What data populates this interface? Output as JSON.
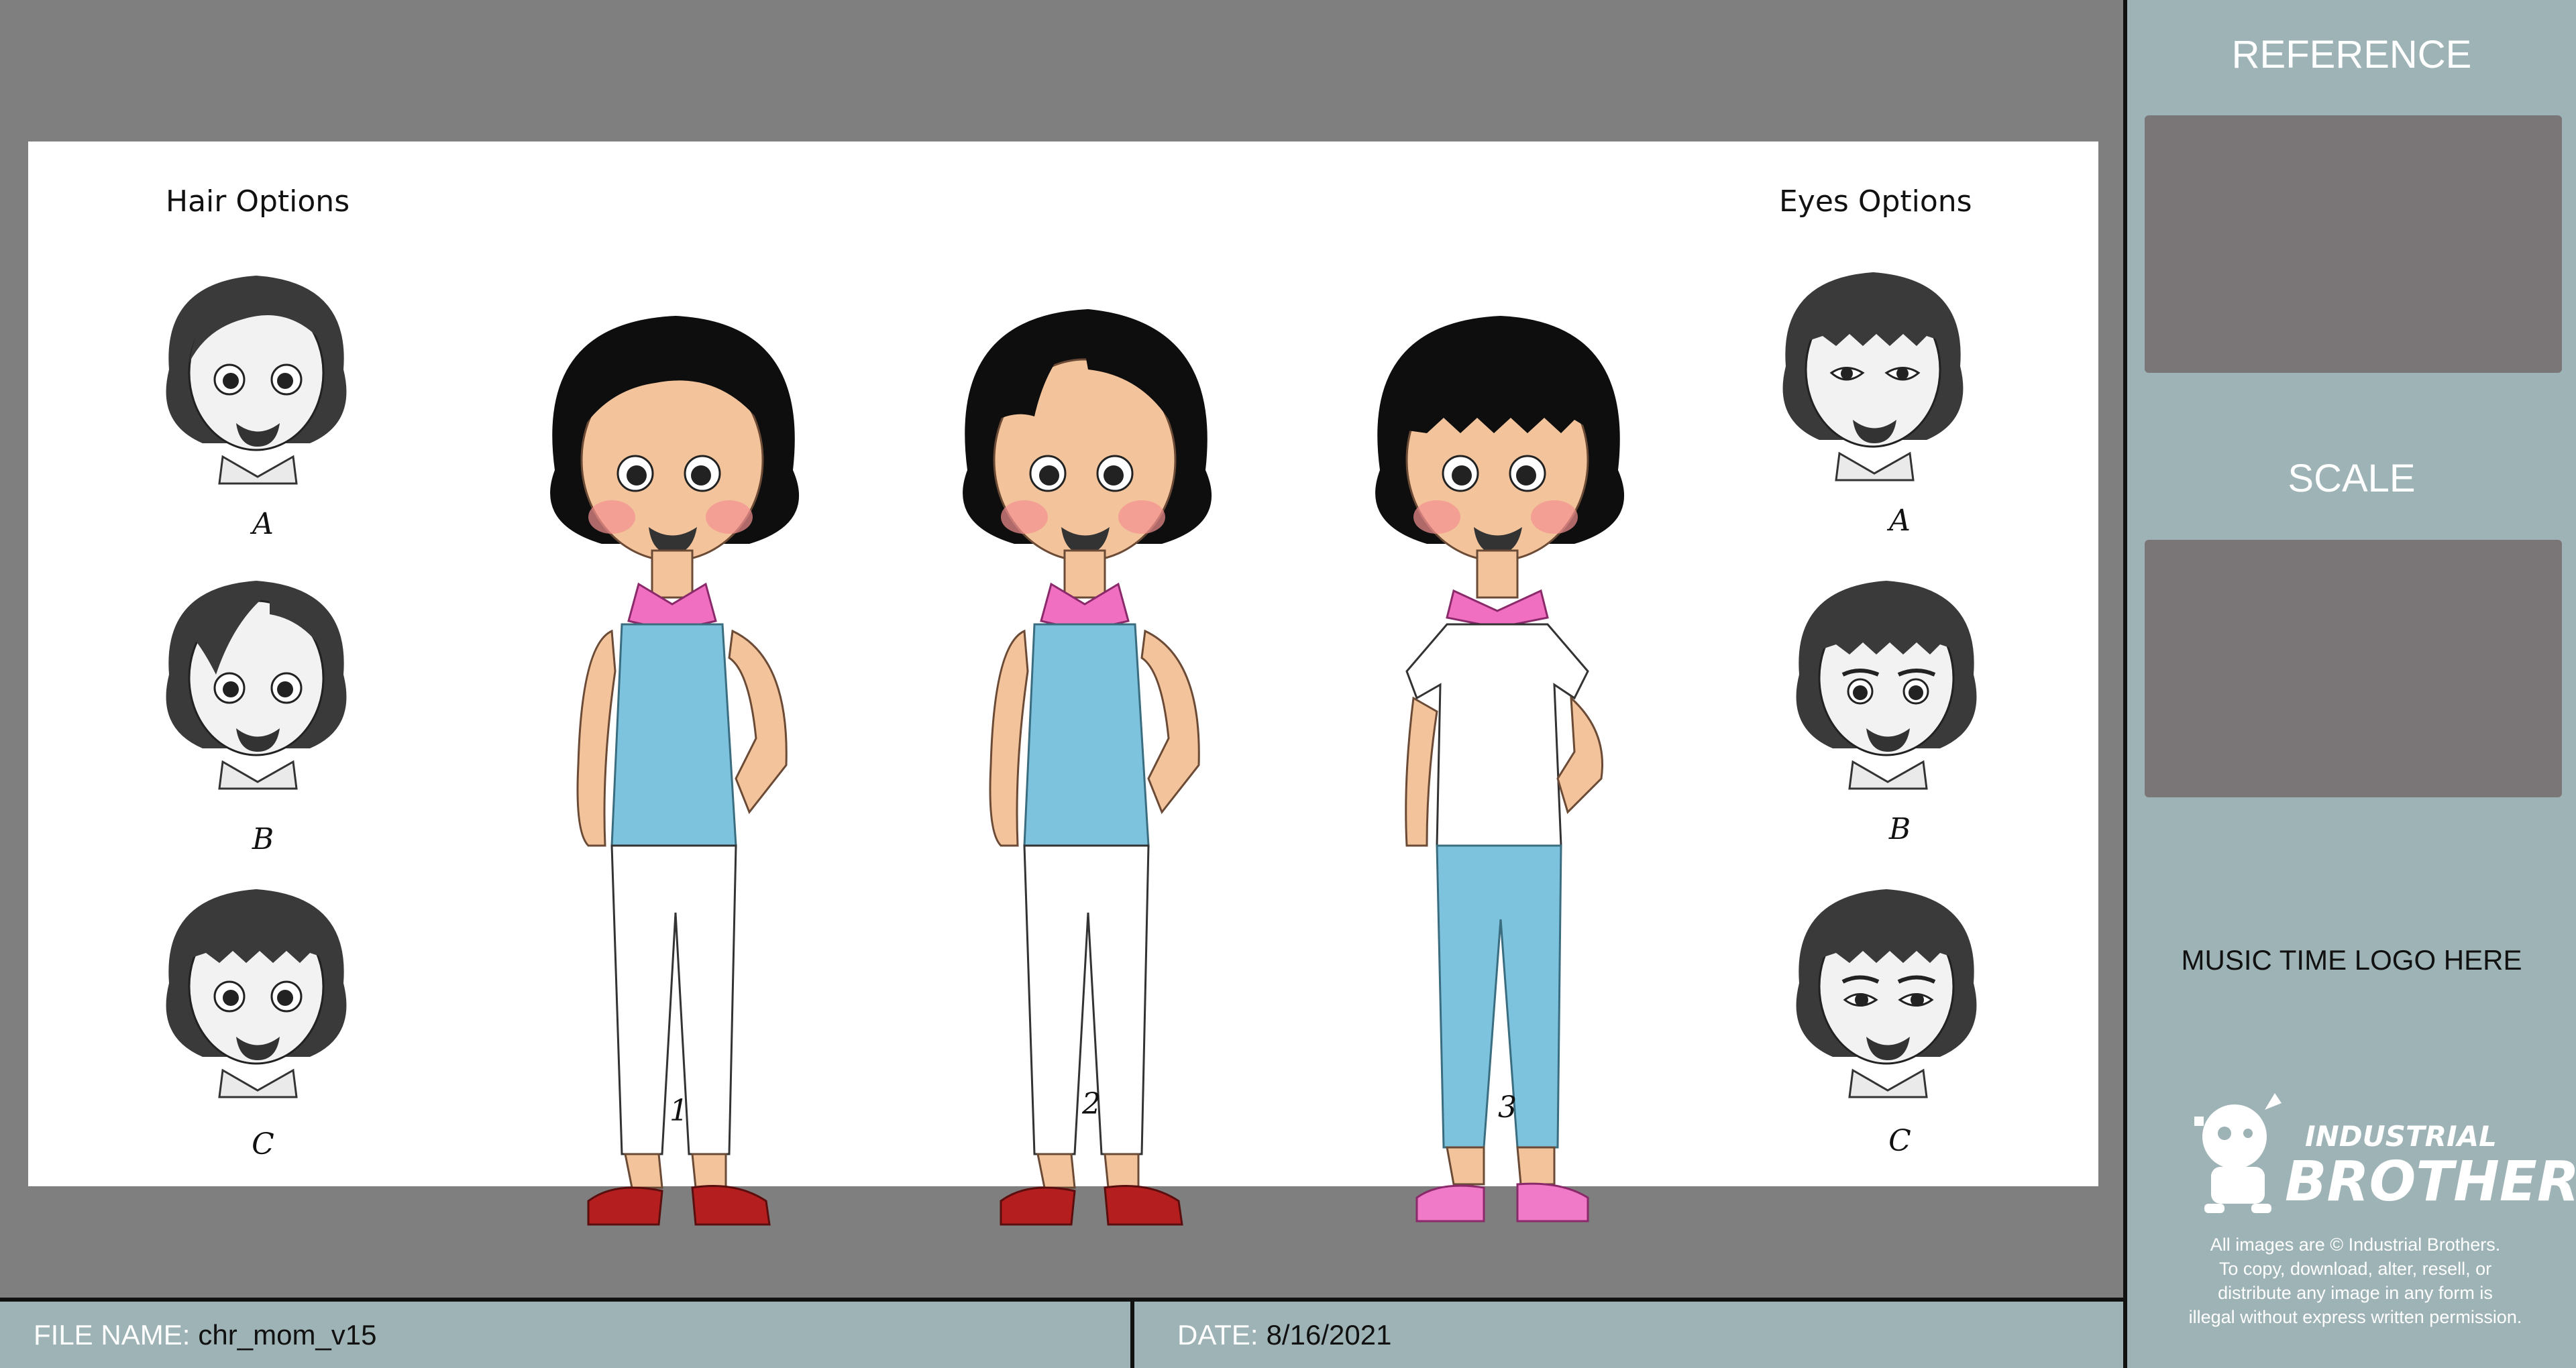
{
  "sheet": {
    "hair_title": "Hair Options",
    "eyes_title": "Eyes Options",
    "hair_labels": [
      "A",
      "B",
      "C"
    ],
    "eyes_labels": [
      "A",
      "B",
      "C"
    ],
    "figure_labels": [
      "1",
      "2",
      "3"
    ]
  },
  "panel": {
    "reference_label": "REFERENCE",
    "scale_label": "SCALE",
    "logo_placeholder": "MUSIC TIME LOGO HERE",
    "brand_line1": "INDUSTRIAL",
    "brand_line2": "BROTHERS",
    "copyright_lines": [
      "All images are © Industrial Brothers.",
      "To copy, download, alter, resell, or",
      "distribute any image in any form is",
      "illegal without express written permission."
    ]
  },
  "footer": {
    "file_label": "FILE NAME:",
    "file_value": "chr_mom_v15",
    "date_label": "DATE:",
    "date_value": "8/16/2021"
  },
  "colors": {
    "panel_bg": "#9eb3b5",
    "canvas_bg": "#7f7f7f",
    "placeholder_box": "#7a7576",
    "top_blue": "#7ec3dd",
    "scarf_pink": "#f06fc0",
    "shoe_red": "#b41e1e",
    "shoe_pink": "#f07ac8",
    "skin": "#f3c49c"
  }
}
